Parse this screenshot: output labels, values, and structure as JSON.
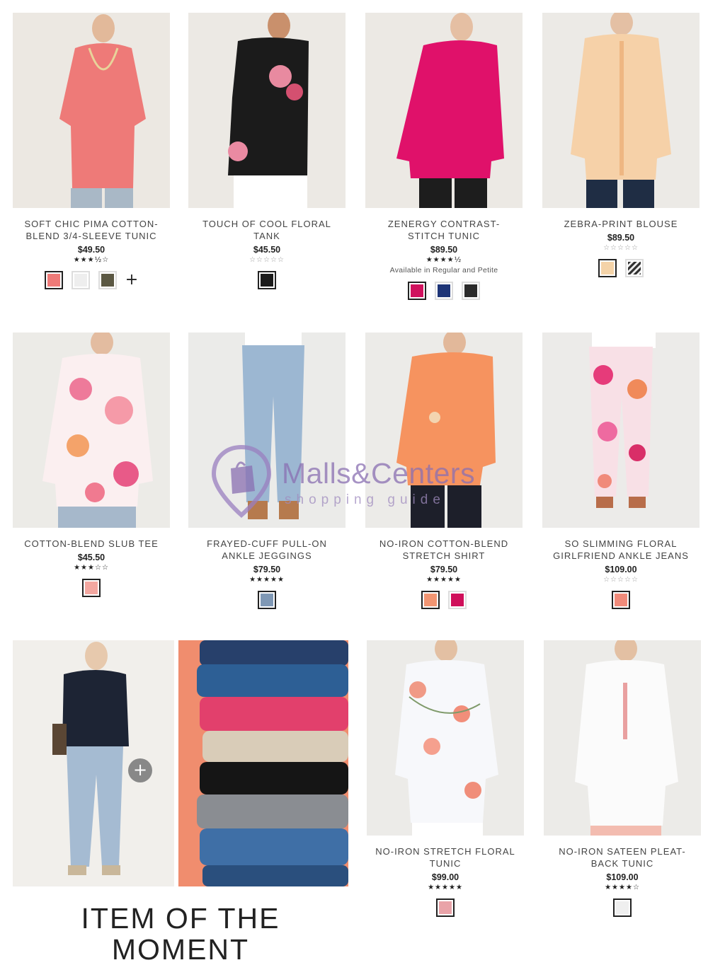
{
  "products": [
    {
      "name": "SOFT CHIC PIMA COTTON-BLEND 3/4-SLEEVE TUNIC",
      "price": "$49.50",
      "stars": "★★★½☆",
      "note": "",
      "more": "+",
      "swatches": [
        "#ee7a78",
        "#eeeeee",
        "#5b5843"
      ]
    },
    {
      "name": "TOUCH OF COOL FLORAL TANK",
      "price": "$45.50",
      "stars": "☆☆☆☆☆",
      "note": "",
      "more": "",
      "swatches": [
        "#1b1b1b"
      ]
    },
    {
      "name": "ZENERGY CONTRAST-STITCH TUNIC",
      "price": "$89.50",
      "stars": "★★★★½",
      "note": "Available in Regular and Petite",
      "more": "",
      "swatches": [
        "#d0125e",
        "#1e3577",
        "#2b2b2b"
      ]
    },
    {
      "name": "ZEBRA-PRINT BLOUSE",
      "price": "$89.50",
      "stars": "☆☆☆☆☆",
      "note": "",
      "more": "",
      "swatches": [
        "#f4d3a8",
        "#9a9a9a"
      ]
    },
    {
      "name": "COTTON-BLEND SLUB TEE",
      "price": "$45.50",
      "stars": "★★★☆☆",
      "note": "",
      "more": "",
      "swatches": [
        "#f3a7a0"
      ]
    },
    {
      "name": "FRAYED-CUFF PULL-ON ANKLE JEGGINGS",
      "price": "$79.50",
      "stars": "★★★★★",
      "note": "",
      "more": "",
      "swatches": [
        "#7f98b5"
      ]
    },
    {
      "name": "NO-IRON COTTON-BLEND STRETCH SHIRT",
      "price": "$79.50",
      "stars": "★★★★★",
      "note": "",
      "more": "",
      "swatches": [
        "#f29572",
        "#cf0f5a"
      ]
    },
    {
      "name": "SO SLIMMING FLORAL GIRLFRIEND ANKLE JEANS",
      "price": "$109.00",
      "stars": "☆☆☆☆☆",
      "note": "",
      "more": "",
      "swatches": [
        "#f08a7a"
      ]
    },
    {
      "name": "NO-IRON STRETCH FLORAL TUNIC",
      "price": "$99.00",
      "stars": "★★★★★",
      "note": "",
      "more": "",
      "swatches": [
        "#e9a3a8"
      ]
    },
    {
      "name": "NO-IRON SATEEN PLEAT-BACK TUNIC",
      "price": "$109.00",
      "stars": "★★★★☆",
      "note": "",
      "more": "",
      "swatches": [
        "#efefef"
      ]
    }
  ],
  "promo": {
    "title": "ITEM OF THE MOMENT",
    "button": "+"
  },
  "watermark": {
    "brand": "Malls&Centers",
    "tagline": "shopping guide"
  }
}
